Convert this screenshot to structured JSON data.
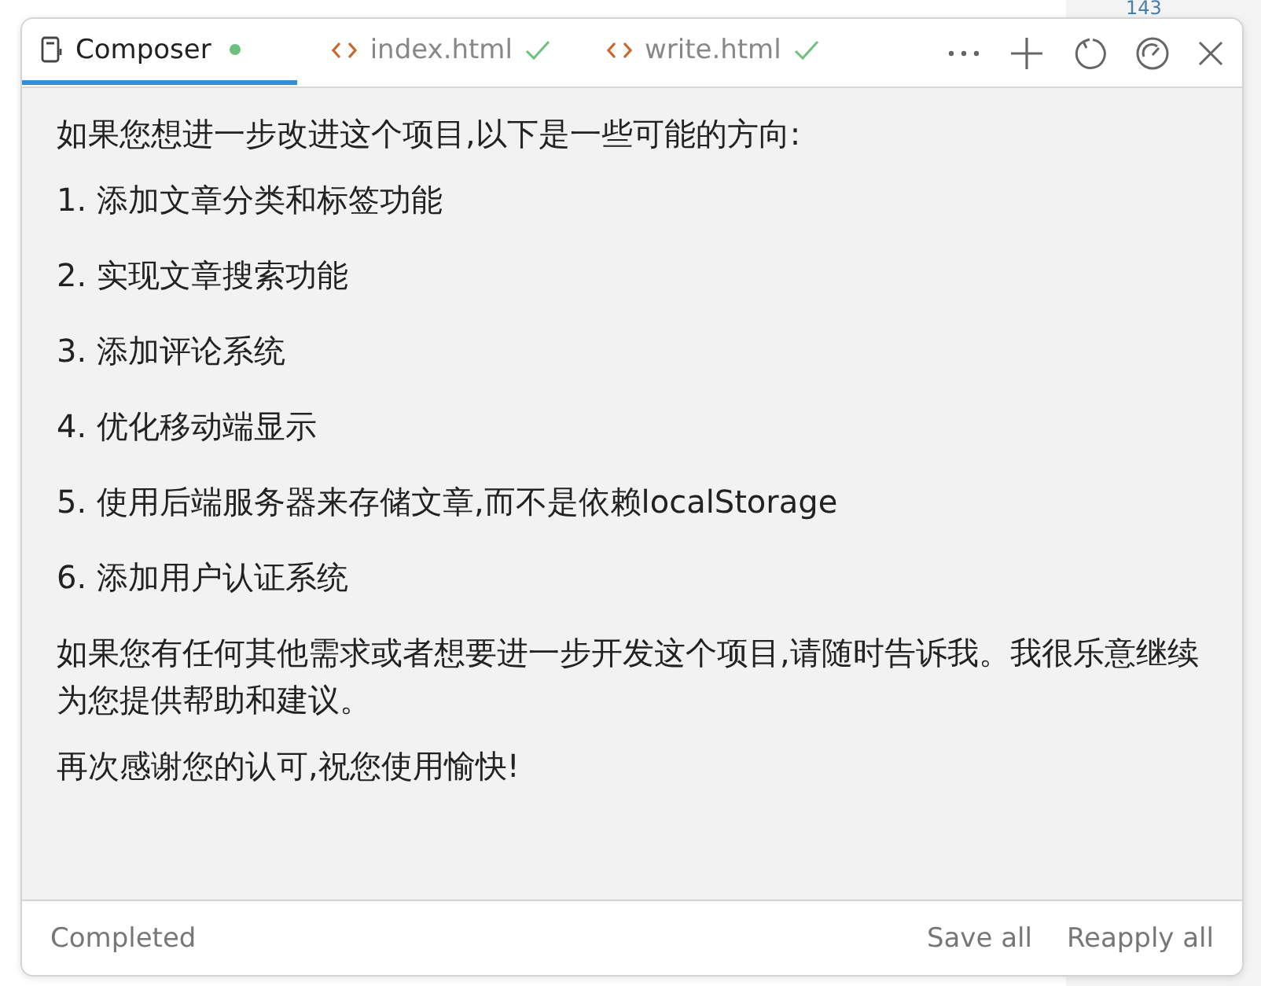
{
  "background": {
    "line_number": "143"
  },
  "tabs": [
    {
      "kind": "composer",
      "label": "Composer",
      "selected": true,
      "unsaved": true,
      "applied": false
    },
    {
      "kind": "file",
      "label": "index.html",
      "selected": false,
      "unsaved": false,
      "applied": true
    },
    {
      "kind": "file",
      "label": "write.html",
      "selected": false,
      "unsaved": false,
      "applied": true
    }
  ],
  "messages": [
    {
      "kind": "para",
      "text": "如果您想进一步改进这个项目,以下是一些可能的方向:"
    },
    {
      "kind": "item",
      "text": "1. 添加文章分类和标签功能"
    },
    {
      "kind": "item",
      "text": "2. 实现文章搜索功能"
    },
    {
      "kind": "item",
      "text": "3. 添加评论系统"
    },
    {
      "kind": "item",
      "text": "4. 优化移动端显示"
    },
    {
      "kind": "item",
      "text": "5. 使用后端服务器来存储文章,而不是依赖localStorage"
    },
    {
      "kind": "item",
      "text": "6. 添加用户认证系统"
    },
    {
      "kind": "para",
      "text": "如果您有任何其他需求或者想要进一步开发这个项目,请随时告诉我。我很乐意继续为您提供帮助和建议。"
    },
    {
      "kind": "para",
      "text": "再次感谢您的认可,祝您使用愉快!"
    }
  ],
  "footer": {
    "status": "Completed",
    "buttons": [
      "Save all",
      "Reapply all"
    ]
  }
}
